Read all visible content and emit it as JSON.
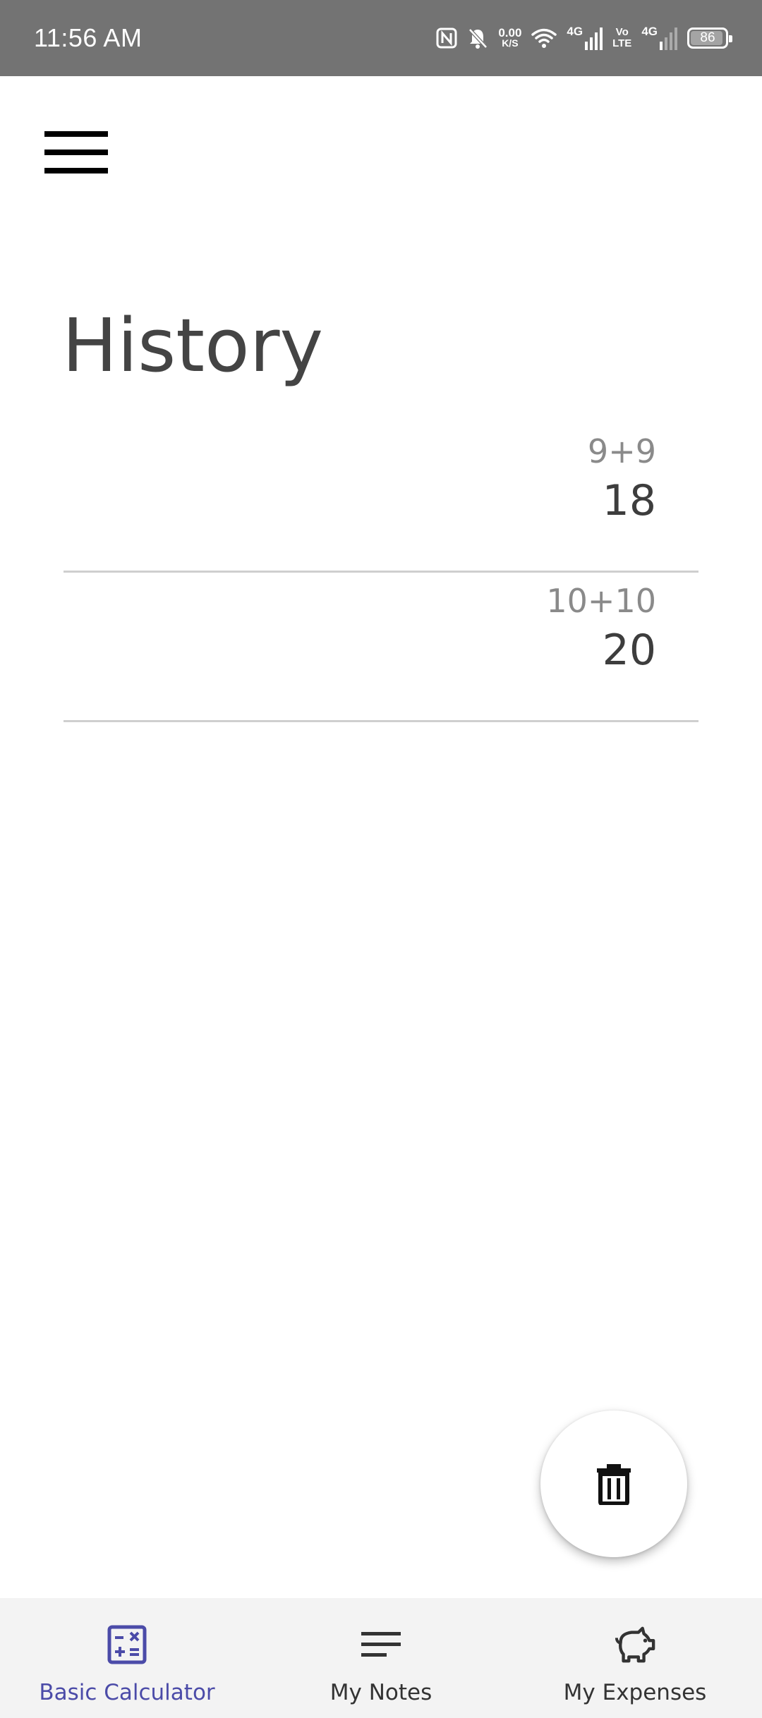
{
  "status_bar": {
    "time": "11:56 AM",
    "network_speed_value": "0.00",
    "network_speed_unit": "K/S",
    "sim1_label": "4G",
    "volte_top": "Vo",
    "volte_bottom": "LTE",
    "sim2_label": "4G",
    "battery_level": "86",
    "icons": [
      "nfc-icon",
      "bell-off-icon",
      "wifi-icon",
      "signal-icon",
      "battery-icon"
    ]
  },
  "header": {
    "menu_icon": "hamburger-icon"
  },
  "main": {
    "title": "History",
    "history": [
      {
        "expression": "9+9",
        "result": "18"
      },
      {
        "expression": "10+10",
        "result": "20"
      }
    ],
    "fab_icon": "trash-icon"
  },
  "bottom_nav": {
    "items": [
      {
        "label": "Basic Calculator",
        "icon": "calculator-icon",
        "active": true
      },
      {
        "label": "My Notes",
        "icon": "notes-icon",
        "active": false
      },
      {
        "label": "My Expenses",
        "icon": "piggy-bank-icon",
        "active": false
      }
    ]
  },
  "colors": {
    "status_bar_bg": "#737373",
    "accent": "#4b4ba8",
    "title_text": "#444444",
    "expression_text": "#8a8a8a",
    "nav_bg": "#f3f3f3"
  }
}
